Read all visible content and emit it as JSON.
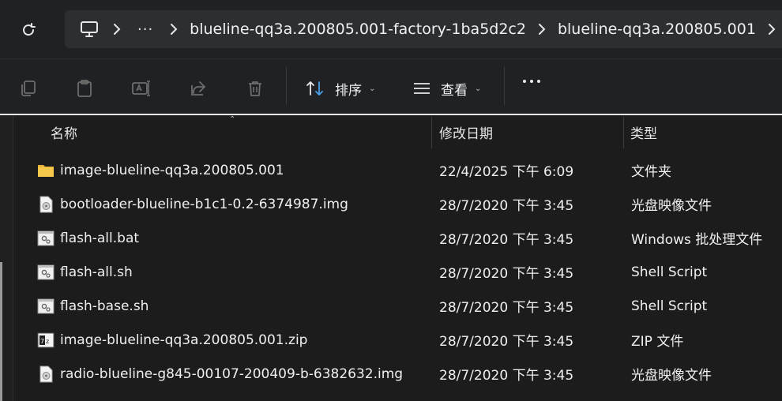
{
  "address": {
    "breadcrumbs": [
      "blueline-qq3a.200805.001-factory-1ba5d2c2",
      "blueline-qq3a.200805.001"
    ],
    "overflow": "···"
  },
  "toolbar": {
    "sort_label": "排序",
    "view_label": "查看"
  },
  "columns": {
    "name": "名称",
    "modified": "修改日期",
    "type": "类型"
  },
  "files": [
    {
      "name": "image-blueline-qq3a.200805.001",
      "modified": "22/4/2025 下午 6:09",
      "type": "文件夹",
      "icon": "folder-icon"
    },
    {
      "name": "bootloader-blueline-b1c1-0.2-6374987.img",
      "modified": "28/7/2020 下午 3:45",
      "type": "光盘映像文件",
      "icon": "disc-image-icon"
    },
    {
      "name": "flash-all.bat",
      "modified": "28/7/2020 下午 3:45",
      "type": "Windows 批处理文件",
      "icon": "script-icon"
    },
    {
      "name": "flash-all.sh",
      "modified": "28/7/2020 下午 3:45",
      "type": "Shell Script",
      "icon": "script-icon"
    },
    {
      "name": "flash-base.sh",
      "modified": "28/7/2020 下午 3:45",
      "type": "Shell Script",
      "icon": "script-icon"
    },
    {
      "name": "image-blueline-qq3a.200805.001.zip",
      "modified": "28/7/2020 下午 3:45",
      "type": "ZIP 文件",
      "icon": "zip-icon"
    },
    {
      "name": "radio-blueline-g845-00107-200409-b-6382632.img",
      "modified": "28/7/2020 下午 3:45",
      "type": "光盘映像文件",
      "icon": "disc-image-icon"
    }
  ]
}
